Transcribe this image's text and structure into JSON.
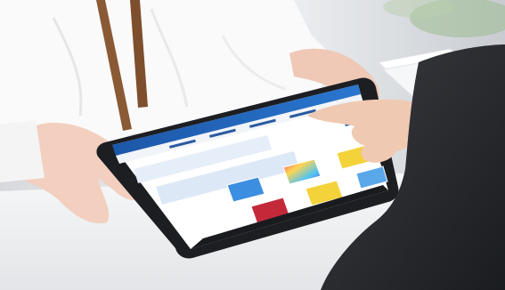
{
  "scene": {
    "description_colors": {
      "wall": "#e9ebee",
      "desk": "#f4f5f6",
      "blouse": "#fbfbfb",
      "lanyard": "#8a5a35",
      "skin": "#f2d0c0",
      "tablet_bezel": "#1d1e22",
      "screen_bg": "#ffffff",
      "header_blue": "#1f5fb3",
      "card_yellow": "#f3d23a",
      "card_blue": "#3c8fe0",
      "card_red": "#c4293a",
      "card_rainbow_1": "#e84b87",
      "card_rainbow_2": "#4fc3f7",
      "card_rainbow_3": "#ffd54f",
      "dark_jacket": "#2a2b2f",
      "plant_green": "#7aa86a"
    },
    "icons": [
      "pointing-hand-icon",
      "holding-hands-icon",
      "tablet-icon",
      "cards-icon"
    ]
  }
}
